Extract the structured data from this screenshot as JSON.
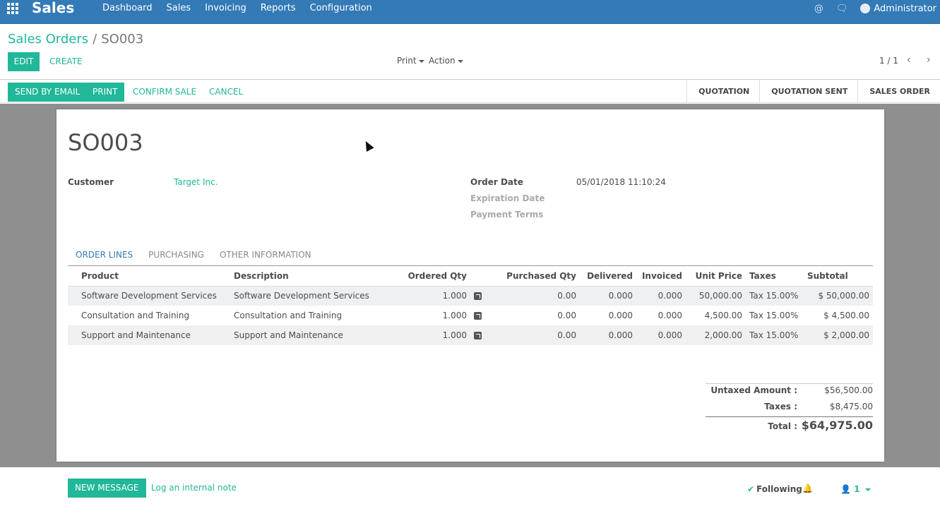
{
  "app": {
    "name": "Sales"
  },
  "topmenu": [
    "Dashboard",
    "Sales",
    "Invoicing",
    "Reports",
    "Configuration"
  ],
  "user": {
    "name": "Administrator"
  },
  "breadcrumb": {
    "parent": "Sales Orders",
    "separator": "/",
    "current": "SO003"
  },
  "toolbar": {
    "edit": "EDIT",
    "create": "CREATE",
    "print": "Print",
    "action": "Action",
    "pager": "1 / 1"
  },
  "statusbar": {
    "send_by_email": "SEND BY EMAIL",
    "print": "PRINT",
    "confirm_sale": "CONFIRM SALE",
    "cancel": "CANCEL",
    "stages": [
      "QUOTATION",
      "QUOTATION SENT",
      "SALES ORDER"
    ]
  },
  "order": {
    "name": "SO003",
    "customer_label": "Customer",
    "customer": "Target Inc.",
    "order_date_label": "Order Date",
    "order_date": "05/01/2018 11:10:24",
    "expiration_label": "Expiration Date",
    "payment_terms_label": "Payment Terms"
  },
  "tabs": [
    "ORDER LINES",
    "PURCHASING",
    "OTHER INFORMATION"
  ],
  "lines": {
    "headers": [
      "Product",
      "Description",
      "Ordered Qty",
      "Purchased Qty",
      "Delivered",
      "Invoiced",
      "Unit Price",
      "Taxes",
      "Subtotal"
    ],
    "rows": [
      [
        "Software Development Services",
        "Software Development Services",
        "1.000",
        "0.00",
        "0.000",
        "0.000",
        "50,000.00",
        "Tax 15.00%",
        "$ 50,000.00"
      ],
      [
        "Consultation and Training",
        "Consultation and Training",
        "1.000",
        "0.00",
        "0.000",
        "0.000",
        "4,500.00",
        "Tax 15.00%",
        "$ 4,500.00"
      ],
      [
        "Support and Maintenance",
        "Support and Maintenance",
        "1.000",
        "0.00",
        "0.000",
        "0.000",
        "2,000.00",
        "Tax 15.00%",
        "$ 2,000.00"
      ]
    ]
  },
  "totals": {
    "untaxed_label": "Untaxed Amount :",
    "untaxed": "$56,500.00",
    "taxes_label": "Taxes :",
    "taxes": "$8,475.00",
    "total_label": "Total :",
    "total": "$64,975.00"
  },
  "chatter": {
    "new_message": "NEW MESSAGE",
    "log_note": "Log an internal note",
    "following": "Following",
    "followers": "1"
  },
  "colors": {
    "primary": "#21b799",
    "navbar": "#337ab7",
    "sheet_bg": "#8f8f8f"
  }
}
